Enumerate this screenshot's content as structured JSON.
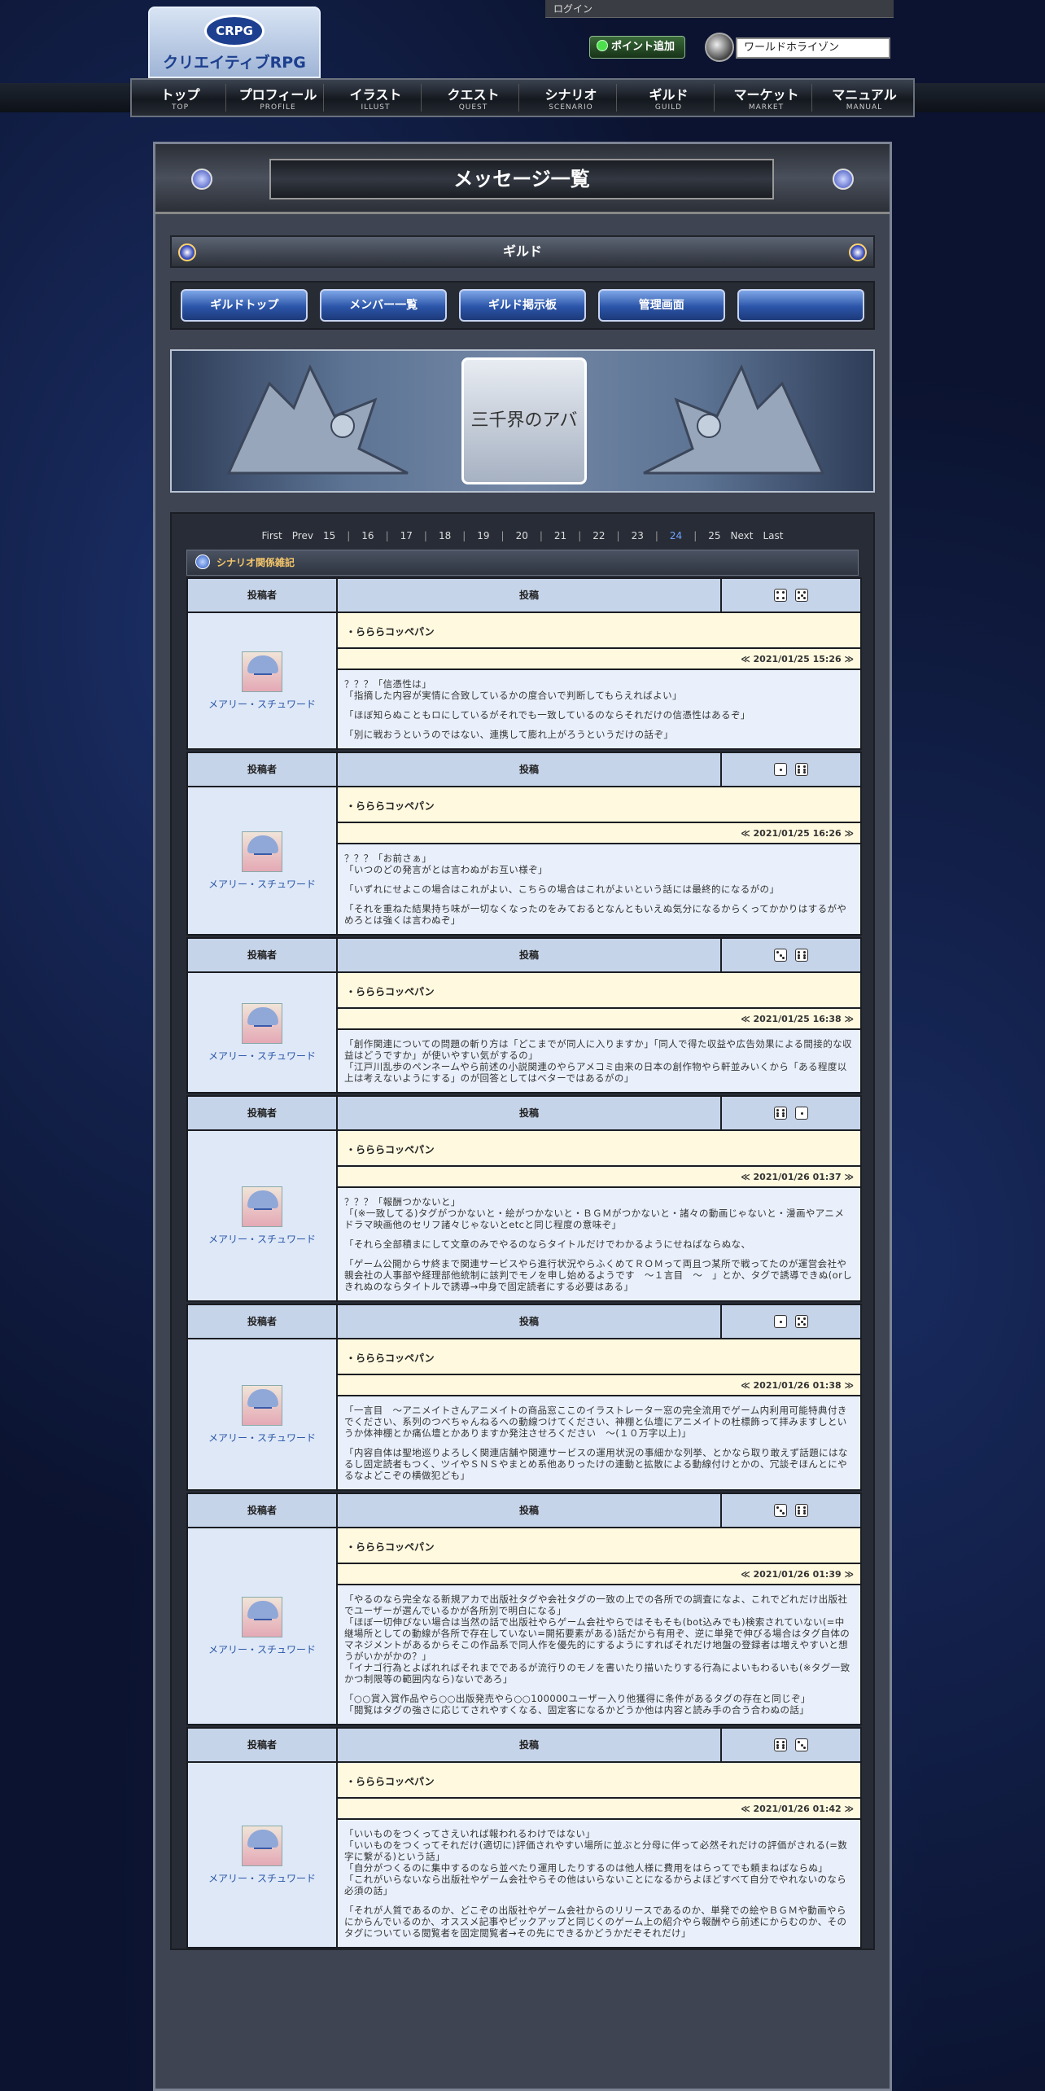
{
  "header": {
    "login": "ログイン",
    "logo_badge": "CRPG",
    "logo_text": "クリエイティブRPG",
    "point_button": "ポイント追加",
    "world": "ワールドホライゾン"
  },
  "nav": [
    {
      "jp": "トップ",
      "en": "TOP"
    },
    {
      "jp": "プロフィール",
      "en": "PROFILE"
    },
    {
      "jp": "イラスト",
      "en": "ILLUST"
    },
    {
      "jp": "クエスト",
      "en": "QUEST"
    },
    {
      "jp": "シナリオ",
      "en": "SCENARIO"
    },
    {
      "jp": "ギルド",
      "en": "GUILD"
    },
    {
      "jp": "マーケット",
      "en": "MARKET"
    },
    {
      "jp": "マニュアル",
      "en": "MANUAL"
    }
  ],
  "page_title": "メッセージ一覧",
  "guild_title": "ギルド",
  "guild_tabs": [
    "ギルドトップ",
    "メンバー一覧",
    "ギルド掲示板",
    "管理画面",
    ""
  ],
  "banner_text": "三千界のアバター",
  "pager": {
    "first": "First",
    "prev": "Prev",
    "pages": [
      "15",
      "16",
      "17",
      "18",
      "19",
      "20",
      "21",
      "22",
      "23",
      "24",
      "25"
    ],
    "current": "24",
    "next": "Next",
    "last": "Last"
  },
  "category": "シナリオ関係雑記",
  "table_labels": {
    "author": "投稿者",
    "post": "投稿"
  },
  "posts": [
    {
      "author": "メアリー・スチュワード",
      "title": "・らららコッペパン",
      "date": "≪ 2021/01/25 15:26 ≫",
      "dice": [
        4,
        5
      ],
      "paragraphs": [
        "？？？「信憑性は」\n「指摘した内容が実情に合致しているかの度合いで判断してもらえればよい」",
        "「ほぼ知らぬこともロにしているがそれでも一致しているのならそれだけの信憑性はあるぞ」",
        "「別に戦おうというのではない、連携して膨れ上がろうというだけの話ぞ」"
      ]
    },
    {
      "author": "メアリー・スチュワード",
      "title": "・らららコッペパン",
      "date": "≪ 2021/01/25 16:26 ≫",
      "dice": [
        1,
        6
      ],
      "paragraphs": [
        "？？？「お前さぁ」\n「いつのどの発言がとは言わぬがお互い様ぞ」",
        "「いずれにせよこの場合はこれがよい、こちらの場合はこれがよいという話には最終的になるがの」",
        "「それを重ねた結果持ち味が一切なくなったのをみておるとなんともいえぬ気分になるからくってかかりはするがやめろとは強くは言わぬぞ」"
      ]
    },
    {
      "author": "メアリー・スチュワード",
      "title": "・らららコッペパン",
      "date": "≪ 2021/01/25 16:38 ≫",
      "dice": [
        3,
        6
      ],
      "paragraphs": [
        "「創作関連についての問題の斬り方は「どこまでが同人に入りますか」「同人で得た収益や広告効果による間接的な収益はどうですか」が使いやすい気がするの」\n「江戸川乱歩のペンネームやら前述の小説関連のやらアメコミ由来の日本の創作物やら軒並みいくから「ある程度以上は考えないようにする」のが回答としてはベターではあるがの」"
      ]
    },
    {
      "author": "メアリー・スチュワード",
      "title": "・らららコッペパン",
      "date": "≪ 2021/01/26 01:37 ≫",
      "dice": [
        6,
        1
      ],
      "paragraphs": [
        "？？？「報酬つかないと」\n「(※一致してる)タグがつかないと・絵がつかないと・ＢＧＭがつかないと・諸々の動画じゃないと・漫画やアニメドラマ映画他のセリフ諸々じゃないとetcと同じ程度の意味ぞ」",
        "「それら全部積まにして文章のみでやるのならタイトルだけでわかるようにせねばならぬな、",
        "「ゲーム公開からサ終まで関連サービスやら進行状況やらふくめてＲＯＭって両且つ某所で戦ってたのが運営会社や親会社の人事部や経理部他統制に該判でモノを申し始めるようです　〜１言目　〜　」とか、タグで誘導できぬ(orしきれぬのならタイトルで誘導→中身で固定読者にする必要はある」"
      ]
    },
    {
      "author": "メアリー・スチュワード",
      "title": "・らららコッペパン",
      "date": "≪ 2021/01/26 01:38 ≫",
      "dice": [
        1,
        5
      ],
      "paragraphs": [
        "「一言目　〜アニメイトさんアニメイトの商品窓ここのイラストレーター窓の完全流用でゲーム内利用可能特典付きでください、系列のつべちゃんねるへの動線つけてください、神棚と仏壇にアニメイトの杜標飾って拝みますしというか体神棚とか痛仏壇とかありますか発注させろください　〜(１０万字以上)」",
        "「内容自体は聖地巡りよろしく関連店舗や関連サービスの運用状況の事細かな列挙、とかなら取り敢えず話題にはなるし固定読者もつく、ツイやＳＮＳやまとめ系他ありったけの連動と拡散による動線付けとかの、冗談ぞほんとにやるなよどこぞの横做犯ども」"
      ]
    },
    {
      "author": "メアリー・スチュワード",
      "title": "・らららコッペパン",
      "date": "≪ 2021/01/26 01:39 ≫",
      "dice": [
        3,
        6
      ],
      "paragraphs": [
        "「やるのなら完全なる新規アカで出版社タグや会社タグの一致の上での各所での調査になよ、これでどれだけ出版社でユーザーが選んでいるかが各所別で明白になる」\n「ほぼ一切伸びない場合は当然の話で出版社やらゲーム会社やらではそもそも(bot込みでも)検索されていない(=中継場所としての動線が各所で存在していない=開拓要素がある)話だから有用ぞ、逆に単発で伸びる場合はタグ自体のマネジメントがあるからそこの作品系で同人作を優先的にするようにすればそれだけ地盤の登録者は増えやすいと想うがいかがかの？」\n「イナゴ行為とよばれればそれまでであるが流行りのモノを書いたり描いたりする行為によいもわるいも(※タグ一致かつ制限等の範囲内なら)ないであろ」",
        "「○○賞入賞作品やら○○出版発売やら○○100000ユーザー入り他獲得に条件があるタグの存在と同じぞ」\n「閲覧はタグの強さに応じてされやすくなる、固定客になるかどうか他は内容と読み手の合う合わぬの話」"
      ]
    },
    {
      "author": "メアリー・スチュワード",
      "title": "・らららコッペパン",
      "date": "≪ 2021/01/26 01:42 ≫",
      "dice": [
        6,
        3
      ],
      "paragraphs": [
        "「いいものをつくってさえいれば報われるわけではない」\n「いいものをつくってそれだけ(適切に)評価されやすい場所に並ぶと分母に伴って必然それだけの評価がされる(=数字に繋がる)という話」\n「自分がつくるのに集中するのなら並べたり運用したりするのは他人様に費用をはらってでも頼まねばならぬ」\n「これがいらないなら出版社やゲーム会社やらその他はいらないことになるからよほどすべて自分でやれないのなら必須の話」",
        "「それが人質であるのか、どこぞの出版社やゲーム会社からのリリースであるのか、単発での絵やＢＧＭや動画やらにからんでいるのか、オススメ記事やピックアップと同じくのゲーム上の紹介やら報酬やら前述にからむのか、そのタグについている閲覧者を固定閲覧者→その先にできるかどうかだぞそれだけ」"
      ]
    }
  ]
}
